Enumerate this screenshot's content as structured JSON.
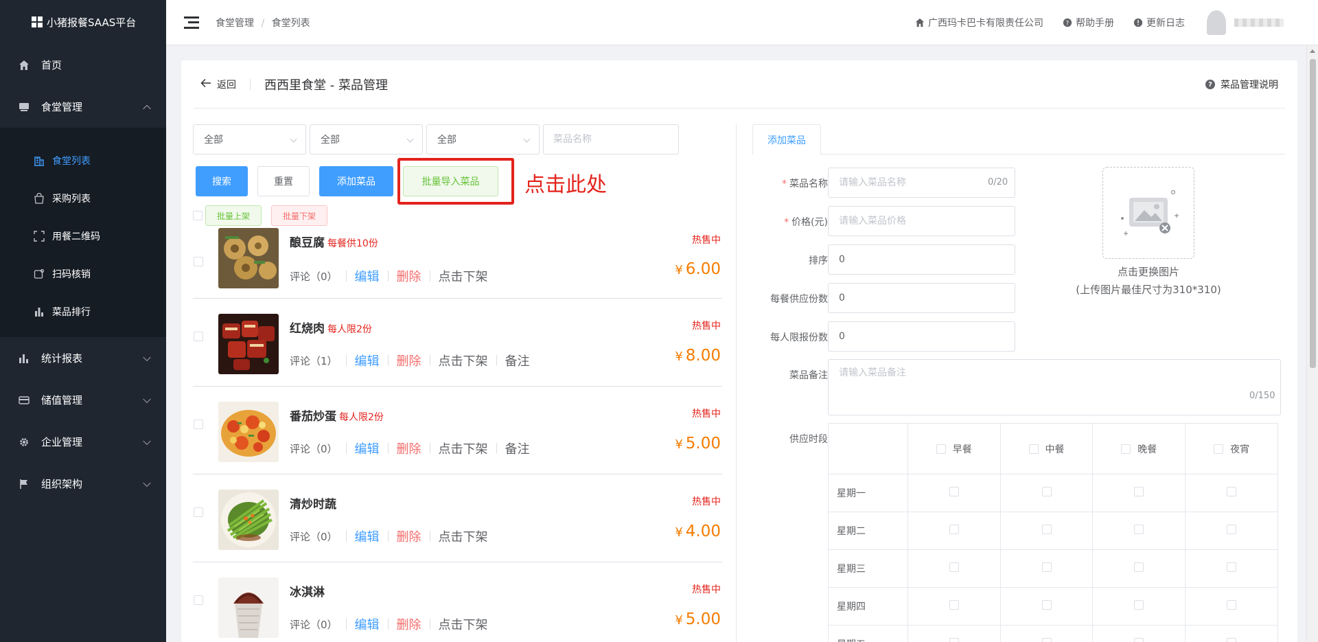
{
  "app": {
    "brand": "小猪报餐SAAS平台"
  },
  "sidebar": {
    "items": [
      {
        "label": "首页",
        "icon": "home-icon"
      },
      {
        "label": "食堂管理",
        "icon": "canteen-icon",
        "expanded": true
      },
      {
        "label": "统计报表",
        "icon": "bar-chart-icon"
      },
      {
        "label": "储值管理",
        "icon": "card-icon"
      },
      {
        "label": "企业管理",
        "icon": "gear-icon"
      },
      {
        "label": "组织架构",
        "icon": "flag-icon"
      }
    ],
    "sub_items": [
      {
        "label": "食堂列表",
        "icon": "building-icon",
        "active": true
      },
      {
        "label": "采购列表",
        "icon": "bag-icon"
      },
      {
        "label": "用餐二维码",
        "icon": "qrcode-icon"
      },
      {
        "label": "扫码核销",
        "icon": "scan-icon"
      },
      {
        "label": "菜品排行",
        "icon": "ranking-icon"
      }
    ]
  },
  "header": {
    "breadcrumb": [
      "食堂管理",
      "食堂列表"
    ],
    "breadcrumb_sep": "/",
    "company": "广西玛卡巴卡有限责任公司",
    "help_manual": "帮助手册",
    "changelog": "更新日志"
  },
  "page": {
    "back_label": "返回",
    "title": "西西里食堂 - 菜品管理",
    "help_label": "菜品管理说明"
  },
  "filters": {
    "select1": "全部",
    "select2": "全部",
    "select3": "全部",
    "name_placeholder": "菜品名称"
  },
  "actions": {
    "search": "搜索",
    "reset": "重置",
    "add": "添加菜品",
    "batch_import": "批量导入菜品",
    "annotation": "点击此处"
  },
  "bulk": {
    "on_shelf": "批量上架",
    "off_shelf": "批量下架"
  },
  "dishes": [
    {
      "name": "酿豆腐",
      "limit": "每餐供10份",
      "status": "热售中",
      "comment": "评论（0）",
      "edit": "编辑",
      "delete": "删除",
      "toggle": "点击下架",
      "note": "",
      "currency": "¥",
      "price": "6.00"
    },
    {
      "name": "红烧肉",
      "limit": "每人限2份",
      "status": "热售中",
      "comment": "评论（1）",
      "edit": "编辑",
      "delete": "删除",
      "toggle": "点击下架",
      "note": "备注",
      "currency": "¥",
      "price": "8.00"
    },
    {
      "name": "番茄炒蛋",
      "limit": "每人限2份",
      "status": "热售中",
      "comment": "评论（0）",
      "edit": "编辑",
      "delete": "删除",
      "toggle": "点击下架",
      "note": "备注",
      "currency": "¥",
      "price": "5.00"
    },
    {
      "name": "清炒时蔬",
      "limit": "",
      "status": "热售中",
      "comment": "评论（0）",
      "edit": "编辑",
      "delete": "删除",
      "toggle": "点击下架",
      "note": "",
      "currency": "¥",
      "price": "4.00"
    },
    {
      "name": "冰淇淋",
      "limit": "",
      "status": "热售中",
      "comment": "评论（0）",
      "edit": "编辑",
      "delete": "删除",
      "toggle": "点击下架",
      "note": "",
      "currency": "¥",
      "price": "5.00"
    }
  ],
  "form": {
    "tab": "添加菜品",
    "name_label": "菜品名称",
    "name_placeholder": "请输入菜品名称",
    "name_counter": "0/20",
    "price_label": "价格(元)",
    "price_placeholder": "请输入菜品价格",
    "sort_label": "排序",
    "sort_value": "0",
    "supply_label": "每餐供应份数",
    "supply_value": "0",
    "limit_label": "每人限报份数",
    "limit_value": "0",
    "note_label": "菜品备注",
    "note_placeholder": "请输入菜品备注",
    "note_counter": "0/150",
    "image_hint": "点击更换图片",
    "image_size_hint": "(上传图片最佳尺寸为310*310)",
    "schedule_label": "供应时段",
    "meals": [
      "早餐",
      "中餐",
      "晚餐",
      "夜宵"
    ],
    "days": [
      "星期一",
      "星期二",
      "星期三",
      "星期四",
      "星期五"
    ]
  },
  "colors": {
    "primary": "#409eff",
    "danger": "#f56c6c",
    "success": "#67c23a",
    "price": "#f57c00",
    "highlight": "#e3231c",
    "sidebar_bg": "#1f2630"
  }
}
